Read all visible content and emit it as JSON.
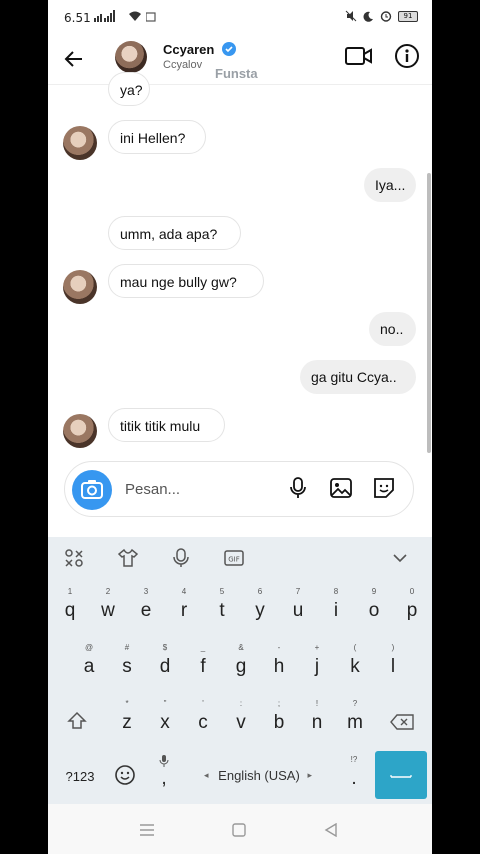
{
  "status_bar": {
    "time": "6.51",
    "battery": "91"
  },
  "header": {
    "name": "Ccyaren",
    "username": "Ccyalov",
    "tag": "Funsta"
  },
  "messages": [
    {
      "text": "ya?",
      "side": "in"
    },
    {
      "text": "ini Hellen?",
      "side": "in"
    },
    {
      "text": "Iya...",
      "side": "out"
    },
    {
      "text": "umm, ada apa?",
      "side": "in"
    },
    {
      "text": "mau nge bully gw?",
      "side": "in"
    },
    {
      "text": "no..",
      "side": "out"
    },
    {
      "text": "ga gitu Ccya..",
      "side": "out"
    },
    {
      "text": "titik titik mulu",
      "side": "in"
    }
  ],
  "composer": {
    "placeholder": "Pesan..."
  },
  "keyboard": {
    "row1": [
      "q",
      "w",
      "e",
      "r",
      "t",
      "y",
      "u",
      "i",
      "o",
      "p"
    ],
    "row1_hints": [
      "1",
      "2",
      "3",
      "4",
      "5",
      "6",
      "7",
      "8",
      "9",
      "0"
    ],
    "row2": [
      "a",
      "s",
      "d",
      "f",
      "g",
      "h",
      "j",
      "k",
      "l"
    ],
    "row2_hints": [
      "@",
      "#",
      "$",
      "_",
      "&",
      "-",
      "+",
      "(",
      ")"
    ],
    "row3": [
      "z",
      "x",
      "c",
      "v",
      "b",
      "n",
      "m"
    ],
    "row3_hints": [
      "*",
      "\"",
      "'",
      ":",
      ";",
      "!",
      "?"
    ],
    "symbols_label": "?123",
    "comma": ",",
    "period": ".",
    "period_hint": "!?",
    "language": "English (USA)"
  },
  "colors": {
    "accent": "#3797f0",
    "enter_key": "#2da5c8",
    "verified": "#3897f0"
  }
}
